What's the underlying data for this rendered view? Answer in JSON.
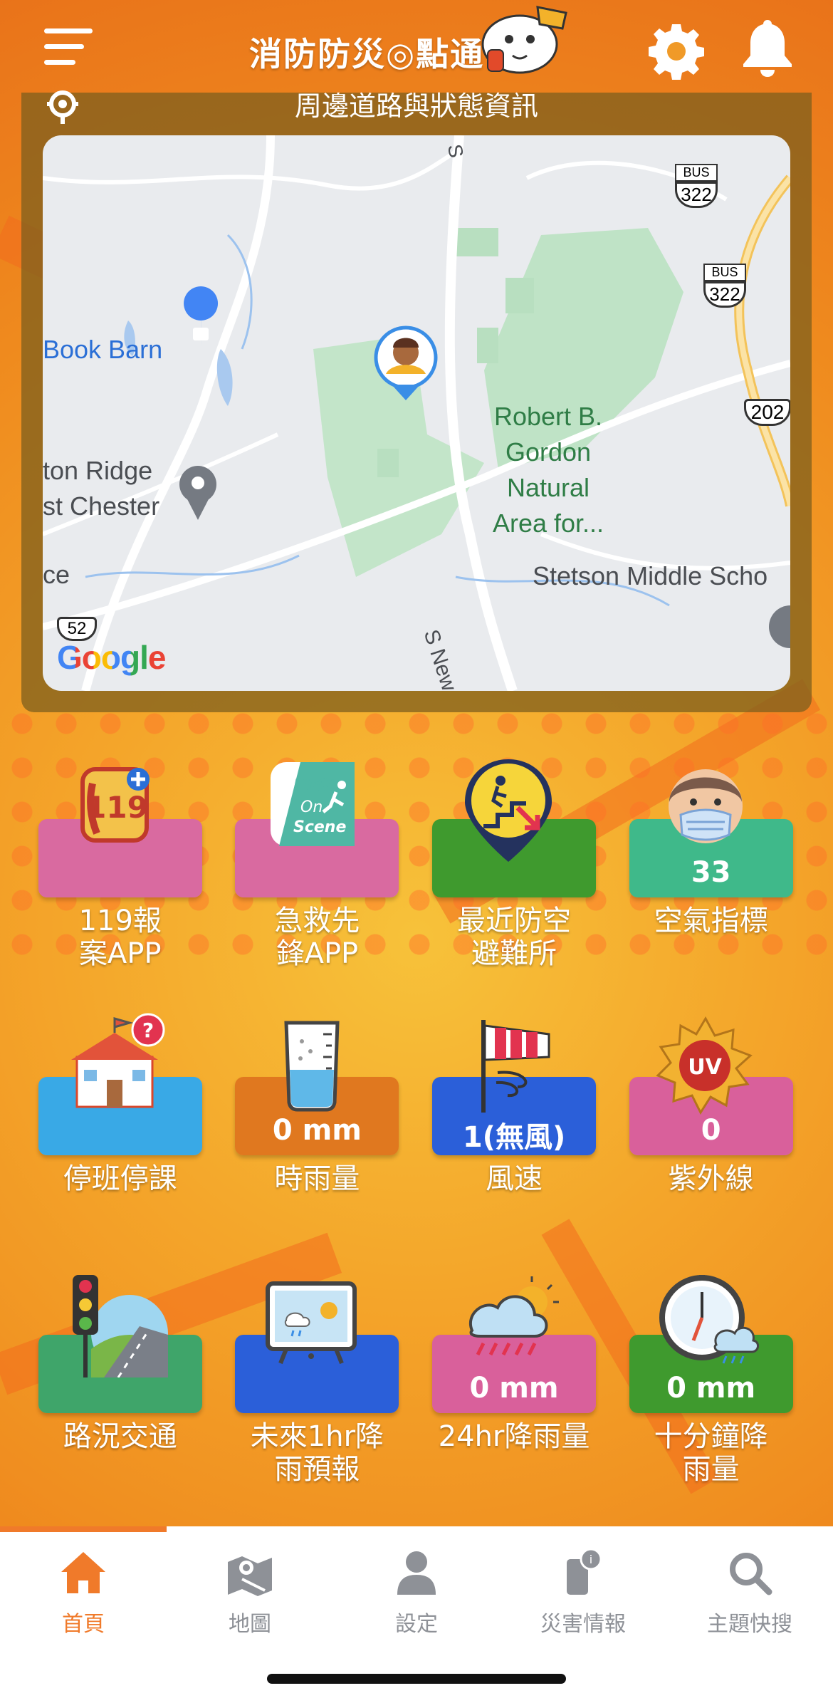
{
  "header": {
    "title": "消防防災◎點通",
    "menu_icon": "hamburger-menu-icon",
    "settings_icon": "gear-icon",
    "notifications_icon": "bell-icon"
  },
  "map_panel": {
    "heading": "周邊道路與狀態資訊",
    "locate_icon": "location-pin-icon",
    "labels": {
      "book_barn": "Book Barn",
      "ridge_1": "ton Ridge",
      "ridge_2": "st Chester",
      "ce": "ce",
      "gordon": "Robert B.\nGordon\nNatural\nArea for...",
      "stetson": "Stetson Middle Scho",
      "street": "S New St",
      "street_top": "S",
      "route_322_a": "322",
      "route_322_b": "322",
      "route_202": "202",
      "route_52": "52",
      "bus_a": "BUS",
      "bus_b": "BUS",
      "google": "Google"
    }
  },
  "tiles": [
    {
      "label": "119報\n案APP",
      "value": "",
      "icon": "119-phone-icon",
      "color": "#d96aa0"
    },
    {
      "label": "急救先\n鋒APP",
      "value": "",
      "icon": "first-on-scene-icon",
      "color": "#d96aa0"
    },
    {
      "label": "最近防空\n避難所",
      "value": "",
      "icon": "shelter-pin-icon",
      "color": "#3f9a2e"
    },
    {
      "label": "空氣指標",
      "value": "33",
      "icon": "face-mask-icon",
      "color": "#3fb98a"
    },
    {
      "label": "停班停課",
      "value": "",
      "icon": "school-question-icon",
      "color": "#39a9e6"
    },
    {
      "label": "時雨量",
      "value": "0 mm",
      "icon": "rain-beaker-icon",
      "color": "#e0781f"
    },
    {
      "label": "風速",
      "value": "1(無風)",
      "icon": "windsock-icon",
      "color": "#2b5fd9"
    },
    {
      "label": "紫外線",
      "value": "0",
      "icon": "uv-sun-icon",
      "color": "#d9609b"
    },
    {
      "label": "路況交通",
      "value": "",
      "icon": "traffic-light-icon",
      "color": "#3fa56a"
    },
    {
      "label": "未來1hr降\n雨預報",
      "value": "",
      "icon": "weather-monitor-icon",
      "color": "#2b5fd9"
    },
    {
      "label": "24hr降雨量",
      "value": "0 mm",
      "icon": "rain-cloud-sun-icon",
      "color": "#d9609b"
    },
    {
      "label": "十分鐘降\n雨量",
      "value": "0 mm",
      "icon": "clock-rain-icon",
      "color": "#3f9a2e"
    }
  ],
  "bottom_nav": {
    "items": [
      {
        "label": "首頁",
        "icon": "home-icon",
        "active": true
      },
      {
        "label": "地圖",
        "icon": "map-icon",
        "active": false
      },
      {
        "label": "設定",
        "icon": "user-icon",
        "active": false
      },
      {
        "label": "災害情報",
        "icon": "phone-info-icon",
        "active": false
      },
      {
        "label": "主題快搜",
        "icon": "search-icon",
        "active": false
      }
    ]
  }
}
